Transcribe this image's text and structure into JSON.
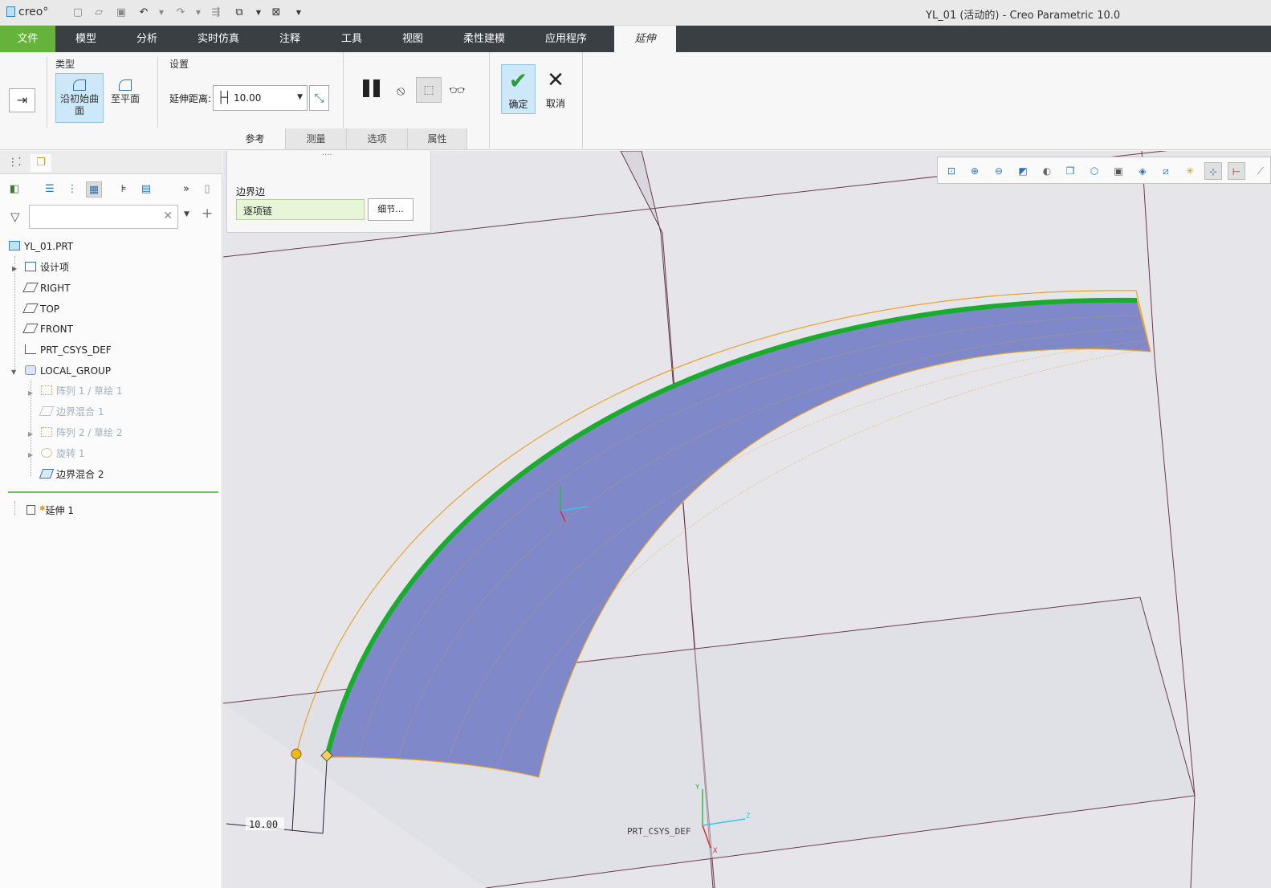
{
  "app": {
    "logo": "creo°",
    "window_title": "YL_01 (活动的) - Creo Parametric 10.0"
  },
  "menu": {
    "file": "文件",
    "items": [
      "模型",
      "分析",
      "实时仿真",
      "注释",
      "工具",
      "视图",
      "柔性建模",
      "应用程序"
    ],
    "active": "延伸"
  },
  "ribbon": {
    "type_group": "类型",
    "type_along_curve": "沿初始曲面",
    "type_to_plane": "至平面",
    "settings_group": "设置",
    "distance_label": "延伸距离:",
    "distance_value": "10.00",
    "ok_label": "确定",
    "cancel_label": "取消",
    "subtabs": [
      "参考",
      "测量",
      "选项",
      "属性"
    ]
  },
  "ref_panel": {
    "dots": "····",
    "boundary_label": "边界边",
    "boundary_value": "逐项链",
    "detail_button": "细节..."
  },
  "tree": {
    "search_placeholder": "",
    "items": [
      {
        "label": "YL_01.PRT"
      },
      {
        "label": "设计项"
      },
      {
        "label": "RIGHT"
      },
      {
        "label": "TOP"
      },
      {
        "label": "FRONT"
      },
      {
        "label": "PRT_CSYS_DEF"
      },
      {
        "label": "LOCAL_GROUP"
      },
      {
        "label": "阵列 1 / 草绘 1"
      },
      {
        "label": "边界混合 1"
      },
      {
        "label": "阵列 2 / 草绘 2"
      },
      {
        "label": "旋转 1"
      },
      {
        "label": "边界混合 2"
      },
      {
        "label": "延伸 1"
      }
    ]
  },
  "viewport": {
    "dimension_value": "10.00",
    "csys_label": "PRT_CSYS_DEF",
    "axis_x": "X",
    "axis_y": "Y",
    "axis_z": "Z",
    "colors": {
      "surface": "#7f88c9",
      "boundary_chain": "#19ad2c",
      "extension_outline": "#e8a52b",
      "datum_plane": "#6b3a4d"
    }
  }
}
